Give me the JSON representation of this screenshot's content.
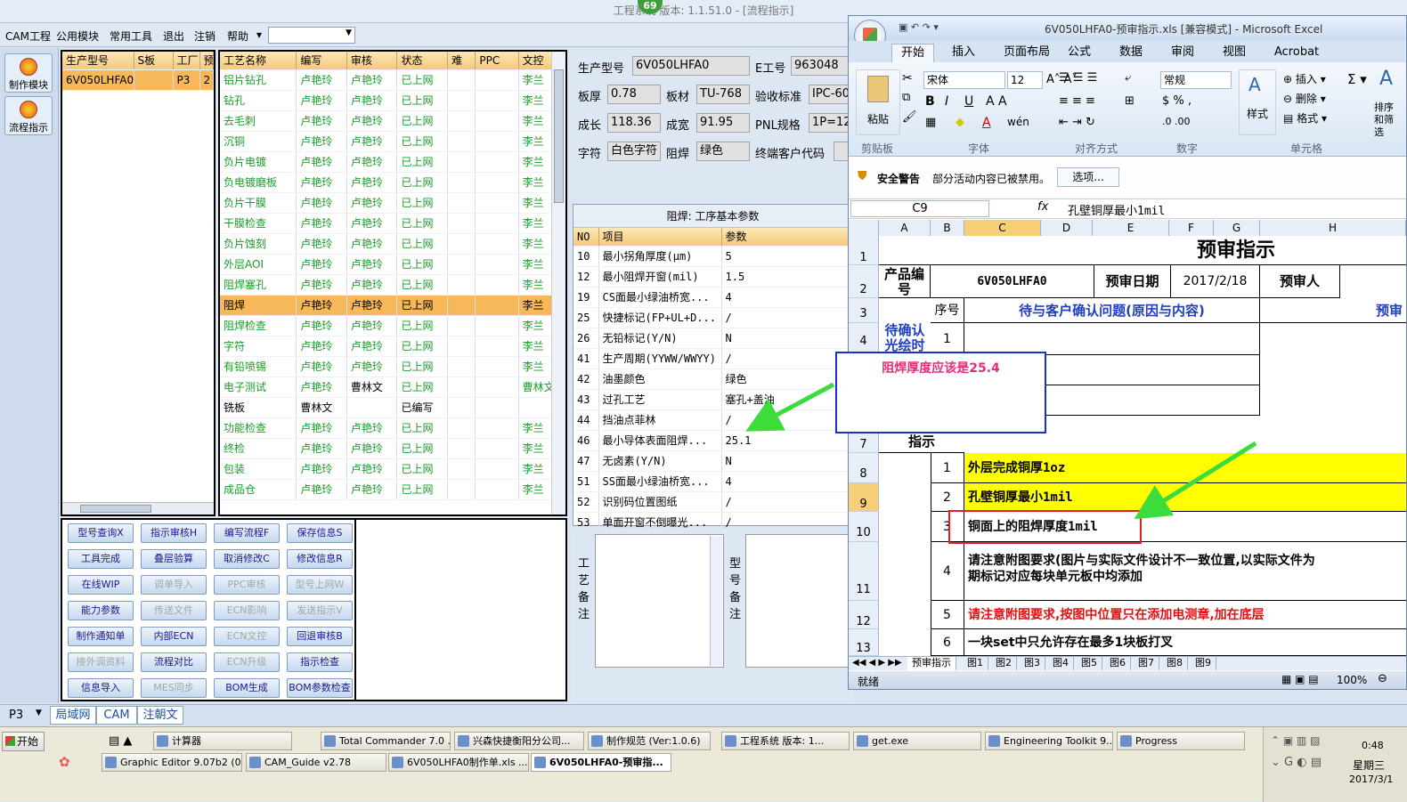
{
  "app": {
    "title": "工程系统 版本: 1.1.51.0 - [流程指示]",
    "badge": "69"
  },
  "menu": {
    "items": [
      "CAM工程",
      "公用模块",
      "常用工具",
      "退出",
      "注销",
      "帮助"
    ]
  },
  "side": {
    "buttons": [
      "制作模块",
      "流程指示"
    ]
  },
  "leftgrid": {
    "headers": [
      "生产型号",
      "S板",
      "工厂",
      "预"
    ],
    "row": [
      "6V050LHFA0",
      "",
      "P3",
      "2"
    ]
  },
  "process": {
    "headers": [
      "工艺名称",
      "编写",
      "审核",
      "状态",
      "难",
      "PPC",
      "文控"
    ],
    "rows": [
      [
        "铝片钻孔",
        "卢艳玲",
        "卢艳玲",
        "已上网",
        "",
        "",
        "李兰"
      ],
      [
        "钻孔",
        "卢艳玲",
        "卢艳玲",
        "已上网",
        "",
        "",
        "李兰"
      ],
      [
        "去毛刺",
        "卢艳玲",
        "卢艳玲",
        "已上网",
        "",
        "",
        "李兰"
      ],
      [
        "沉铜",
        "卢艳玲",
        "卢艳玲",
        "已上网",
        "",
        "",
        "李兰"
      ],
      [
        "负片电镀",
        "卢艳玲",
        "卢艳玲",
        "已上网",
        "",
        "",
        "李兰"
      ],
      [
        "负电镀磨板",
        "卢艳玲",
        "卢艳玲",
        "已上网",
        "",
        "",
        "李兰"
      ],
      [
        "负片干膜",
        "卢艳玲",
        "卢艳玲",
        "已上网",
        "",
        "",
        "李兰"
      ],
      [
        "干膜检查",
        "卢艳玲",
        "卢艳玲",
        "已上网",
        "",
        "",
        "李兰"
      ],
      [
        "负片蚀刻",
        "卢艳玲",
        "卢艳玲",
        "已上网",
        "",
        "",
        "李兰"
      ],
      [
        "外层AOI",
        "卢艳玲",
        "卢艳玲",
        "已上网",
        "",
        "",
        "李兰"
      ],
      [
        "阻焊塞孔",
        "卢艳玲",
        "卢艳玲",
        "已上网",
        "",
        "",
        "李兰"
      ],
      [
        "阻焊",
        "卢艳玲",
        "卢艳玲",
        "已上网",
        "",
        "",
        "李兰"
      ],
      [
        "阻焊检查",
        "卢艳玲",
        "卢艳玲",
        "已上网",
        "",
        "",
        "李兰"
      ],
      [
        "字符",
        "卢艳玲",
        "卢艳玲",
        "已上网",
        "",
        "",
        "李兰"
      ],
      [
        "有铅喷锡",
        "卢艳玲",
        "卢艳玲",
        "已上网",
        "",
        "",
        "李兰"
      ],
      [
        "电子测试",
        "卢艳玲",
        "曹林文",
        "已上网",
        "",
        "",
        "曹林文"
      ],
      [
        "铣板",
        "曹林文",
        "",
        "已编写",
        "",
        "",
        ""
      ],
      [
        "功能检查",
        "卢艳玲",
        "卢艳玲",
        "已上网",
        "",
        "",
        "李兰"
      ],
      [
        "终检",
        "卢艳玲",
        "卢艳玲",
        "已上网",
        "",
        "",
        "李兰"
      ],
      [
        "包装",
        "卢艳玲",
        "卢艳玲",
        "已上网",
        "",
        "",
        "李兰"
      ],
      [
        "成品仓",
        "卢艳玲",
        "卢艳玲",
        "已上网",
        "",
        "",
        "李兰"
      ]
    ]
  },
  "buttons": [
    [
      "型号查询X",
      "指示审核H",
      "编写流程F",
      "保存信息S"
    ],
    [
      "工具完成",
      "叠层验算",
      "取消修改C",
      "修改信息R"
    ],
    [
      "在线WIP",
      "调单导入",
      "PPC审核",
      "型号上网W"
    ],
    [
      "能力参数",
      "传送文件",
      "ECN影响",
      "发送指示V"
    ],
    [
      "制作通知单",
      "内部ECN",
      "ECN文控",
      "回退审核B"
    ],
    [
      "接外调资料",
      "流程对比",
      "ECN升级",
      "指示检查"
    ],
    [
      "信息导入",
      "MES同步",
      "BOM生成",
      "BOM参数检查"
    ]
  ],
  "info": {
    "prod_model_label": "生产型号",
    "prod_model": "6V050LHFA0",
    "e_no_label": "E工号",
    "e_no": "963048",
    "thick_label": "板厚",
    "thick": "0.78",
    "mat_label": "板材",
    "mat": "TU-768",
    "std_label": "验收标准",
    "std": "IPC-60",
    "len_label": "成长",
    "len": "118.36",
    "wid_label": "成宽",
    "wid": "91.95",
    "pnl_label": "PNL规格",
    "pnl": "1P=12",
    "char_label": "字符",
    "char": "白色字符",
    "mask_label": "阻焊",
    "mask": "绿色",
    "cust_label": "终端客户代码"
  },
  "params": {
    "title": "阻焊: 工序基本参数",
    "headers": [
      "NO",
      "项目",
      "参数"
    ],
    "rows": [
      [
        "10",
        "最小拐角厚度(μm)",
        "5"
      ],
      [
        "12",
        "最小阻焊开窗(mil)",
        "1.5"
      ],
      [
        "19",
        "CS面最小绿油桥宽...",
        "4"
      ],
      [
        "25",
        "快捷标记(FP+UL+D...",
        "/"
      ],
      [
        "26",
        "无铅标记(Y/N)",
        "N"
      ],
      [
        "41",
        "生产周期(YYWW/WWYY)",
        "/"
      ],
      [
        "42",
        "油墨颜色",
        "绿色"
      ],
      [
        "43",
        "过孔工艺",
        "塞孔+盖油"
      ],
      [
        "44",
        "挡油点菲林",
        "/"
      ],
      [
        "46",
        "最小导体表面阻焊...",
        "25.1"
      ],
      [
        "47",
        "无卤素(Y/N)",
        "N"
      ],
      [
        "51",
        "SS面最小绿油桥宽...",
        "4"
      ],
      [
        "52",
        "识别码位置图纸",
        "/"
      ],
      [
        "53",
        "单面开窗不倒曝光...",
        "/"
      ]
    ],
    "note1": "工艺备注",
    "note2": "型号备注"
  },
  "annotation": {
    "text": "阻焊厚度应该是25.4",
    "color": "#ff3366"
  },
  "excel": {
    "title": "6V050LHFA0-预审指示.xls [兼容模式] - Microsoft Excel",
    "tabs": [
      "开始",
      "插入",
      "页面布局",
      "公式",
      "数据",
      "审阅",
      "视图",
      "Acrobat"
    ],
    "font_name": "宋体",
    "font_size": "12",
    "num_format": "常规",
    "groups": [
      "剪贴板",
      "字体",
      "对齐方式",
      "数字",
      "样式",
      "单元格"
    ],
    "paste": "粘贴",
    "style_btn": "样式",
    "insert": "插入",
    "delete": "删除",
    "format": "格式",
    "sort": "排序和筛选",
    "security_label": "安全警告",
    "security_text": "部分活动内容已被禁用。",
    "options": "选项...",
    "cell_ref": "C9",
    "formula": "孔壁铜厚最小1mil",
    "cols": [
      "A",
      "B",
      "C",
      "D",
      "E",
      "F",
      "G",
      "H"
    ],
    "sheet_title": "预审指示",
    "r2": {
      "a": "产品编号",
      "c": "6V050LHFA0",
      "e": "预审日期",
      "f": "2017/2/18",
      "h": "预审人"
    },
    "r3": {
      "b": "序号",
      "c": "待与客户确认问题(原因与内容)",
      "h": "预审"
    },
    "r4": {
      "a": "待确认光绘时",
      "b": "1"
    },
    "r7": {
      "a": "指示"
    },
    "items": [
      {
        "n": "1",
        "t": "外层完成铜厚1oz"
      },
      {
        "n": "2",
        "t": "孔壁铜厚最小1mil"
      },
      {
        "n": "3",
        "t": "铜面上的阻焊厚度1mil"
      },
      {
        "n": "4",
        "t": "请注意附图要求(图片与实际文件设计不一致位置,以实际文件为",
        "t2": "期标记对应每块单元板中均添加"
      },
      {
        "n": "5",
        "t": "请注意附图要求,按图中位置只在添加电测章,加在底层"
      },
      {
        "n": "6",
        "t": "一块set中只允许存在最多1块板打叉"
      }
    ],
    "rownums": [
      "1",
      "2",
      "3",
      "4",
      "7",
      "8",
      "9",
      "10",
      "11",
      "12",
      "13"
    ],
    "sheets": [
      "预审指示",
      "图1",
      "图2",
      "图3",
      "图4",
      "图5",
      "图6",
      "图7",
      "图8",
      "图9"
    ],
    "status": "就绪",
    "zoom": "100%"
  },
  "statusbar": {
    "combo": "P3",
    "tabs": [
      "局域网",
      "CAM",
      "注朝文"
    ]
  },
  "taskbar": {
    "start": "开始",
    "row1": [
      "计算器",
      "Total Commander 7.0 ...",
      "兴森快捷衡阳分公司...",
      "制作规范 (Ver:1.0.6)",
      "工程系统 版本: 1...",
      "get.exe",
      "Engineering Toolkit 9....",
      "Progress"
    ],
    "row2": [
      "Graphic Editor 9.07b2 (0...",
      "CAM_Guide v2.78",
      "6V050LHFA0制作单.xls ...",
      "6V050LHFA0-预审指..."
    ],
    "time": "0:48",
    "weekday": "星期三",
    "date": "2017/3/1"
  }
}
